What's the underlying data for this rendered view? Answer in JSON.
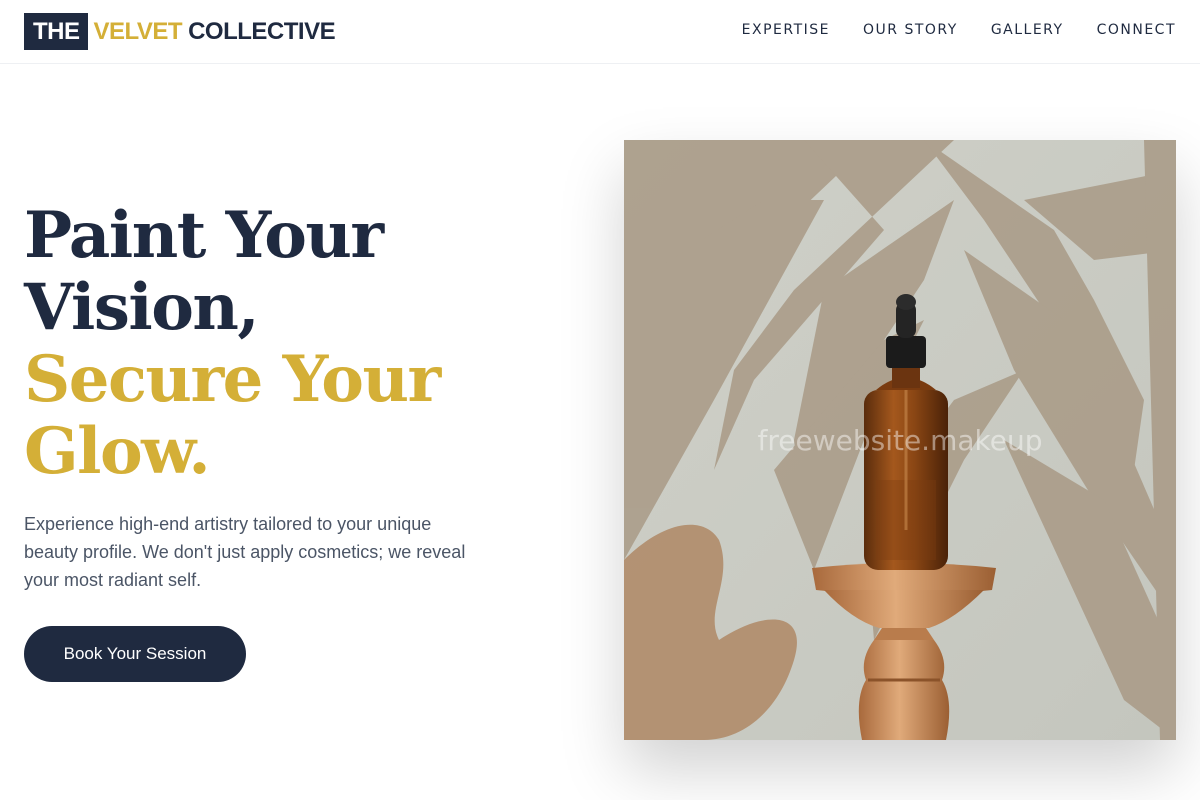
{
  "brand": {
    "the": "THE",
    "velvet": "VELVET",
    "collective": "COLLECTIVE"
  },
  "nav": {
    "items": [
      "EXPERTISE",
      "OUR STORY",
      "GALLERY",
      "CONNECT"
    ]
  },
  "hero": {
    "headline_lines": [
      "Paint Your",
      "Vision,",
      "Secure Your",
      "Glow."
    ],
    "subtext": "Experience high-end artistry tailored to your unique beauty profile. We don't just apply cosmetics; we reveal your most radiant self.",
    "cta_label": "Book Your Session",
    "image_watermark": "freewebsite.makeup"
  },
  "colors": {
    "navy": "#1f2a40",
    "gold": "#d4af37",
    "body_text": "#4b5566"
  }
}
